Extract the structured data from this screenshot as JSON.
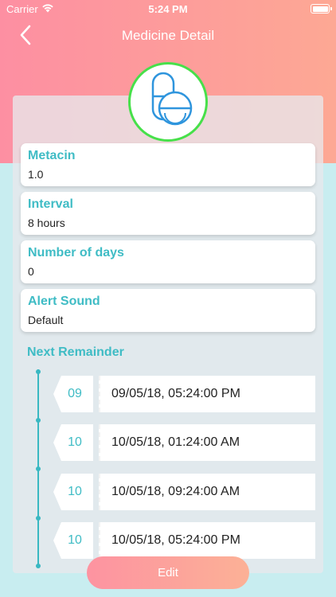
{
  "status_bar": {
    "carrier": "Carrier",
    "time": "5:24 PM"
  },
  "nav": {
    "title": "Medicine Detail"
  },
  "fields": [
    {
      "label": "Metacin",
      "value": "1.0"
    },
    {
      "label": "Interval",
      "value": "8 hours"
    },
    {
      "label": "Number of days",
      "value": "0"
    },
    {
      "label": "Alert Sound",
      "value": "Default"
    }
  ],
  "next_reminder": {
    "label": "Next Remainder",
    "items": [
      {
        "day": "09",
        "datetime": "09/05/18, 05:24:00 PM"
      },
      {
        "day": "10",
        "datetime": "10/05/18, 01:24:00 AM"
      },
      {
        "day": "10",
        "datetime": "10/05/18, 09:24:00 AM"
      },
      {
        "day": "10",
        "datetime": "10/05/18, 05:24:00 PM"
      }
    ]
  },
  "actions": {
    "edit_label": "Edit"
  },
  "colors": {
    "accent": "#3fbcc5",
    "header_gradient_start": "#fd8fa2",
    "header_gradient_end": "#fda894",
    "pill_ring": "#47e04a",
    "background": "#c8edf0"
  },
  "icons": {
    "back": "chevron-left-icon",
    "pill": "pill-capsule-icon",
    "wifi": "wifi-icon",
    "battery": "battery-icon"
  }
}
